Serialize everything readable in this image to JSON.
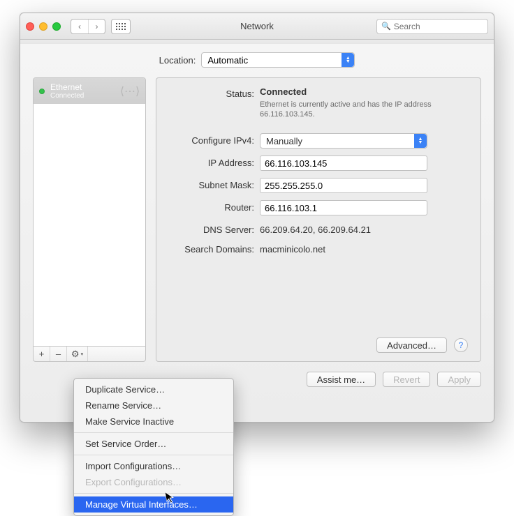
{
  "window": {
    "title": "Network",
    "search_placeholder": "Search"
  },
  "location": {
    "label": "Location:",
    "value": "Automatic"
  },
  "sidebar": {
    "items": [
      {
        "name": "Ethernet",
        "status": "Connected"
      }
    ]
  },
  "details": {
    "status_label": "Status:",
    "status_value": "Connected",
    "status_detail": "Ethernet is currently active and has the IP address 66.116.103.145.",
    "configure_label": "Configure IPv4:",
    "configure_value": "Manually",
    "ip_label": "IP Address:",
    "ip_value": "66.116.103.145",
    "mask_label": "Subnet Mask:",
    "mask_value": "255.255.255.0",
    "router_label": "Router:",
    "router_value": "66.116.103.1",
    "dns_label": "DNS Server:",
    "dns_value": "66.209.64.20, 66.209.64.21",
    "search_label": "Search Domains:",
    "search_value": "macminicolo.net",
    "advanced": "Advanced…"
  },
  "buttons": {
    "assist": "Assist me…",
    "revert": "Revert",
    "apply": "Apply"
  },
  "menu": {
    "duplicate": "Duplicate Service…",
    "rename": "Rename Service…",
    "inactive": "Make Service Inactive",
    "order": "Set Service Order…",
    "import": "Import Configurations…",
    "export": "Export Configurations…",
    "manage": "Manage Virtual Interfaces…"
  }
}
